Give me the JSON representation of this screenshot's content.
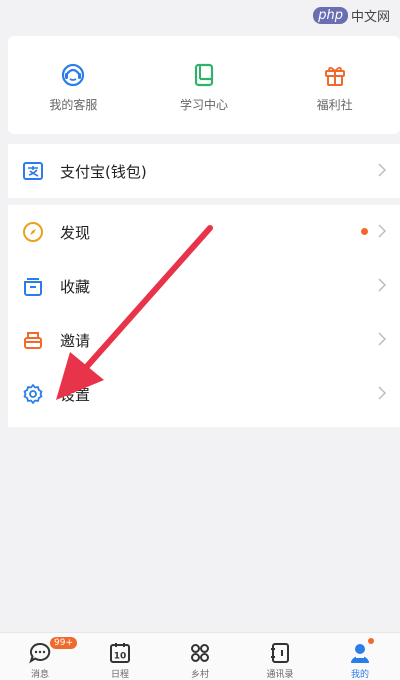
{
  "watermark": {
    "logo": "php",
    "text": "中文网"
  },
  "quick": [
    {
      "label": "我的客服",
      "icon": "customer-service-icon",
      "color": "#2b7de9"
    },
    {
      "label": "学习中心",
      "icon": "book-icon",
      "color": "#2fb36b"
    },
    {
      "label": "福利社",
      "icon": "gift-icon",
      "color": "#f06a2b"
    }
  ],
  "menu": {
    "alipay": "支付宝(钱包)",
    "discover": "发现",
    "favorites": "收藏",
    "invite": "邀请",
    "settings": "设置"
  },
  "tabbar": {
    "messages": "消息",
    "messages_badge": "99+",
    "calendar": "日程",
    "calendar_day": "10",
    "village": "乡村",
    "contacts": "通讯录",
    "me": "我的"
  },
  "colors": {
    "accent": "#2b7de9",
    "red": "#f06a2b",
    "arrow": "#e8344a"
  }
}
